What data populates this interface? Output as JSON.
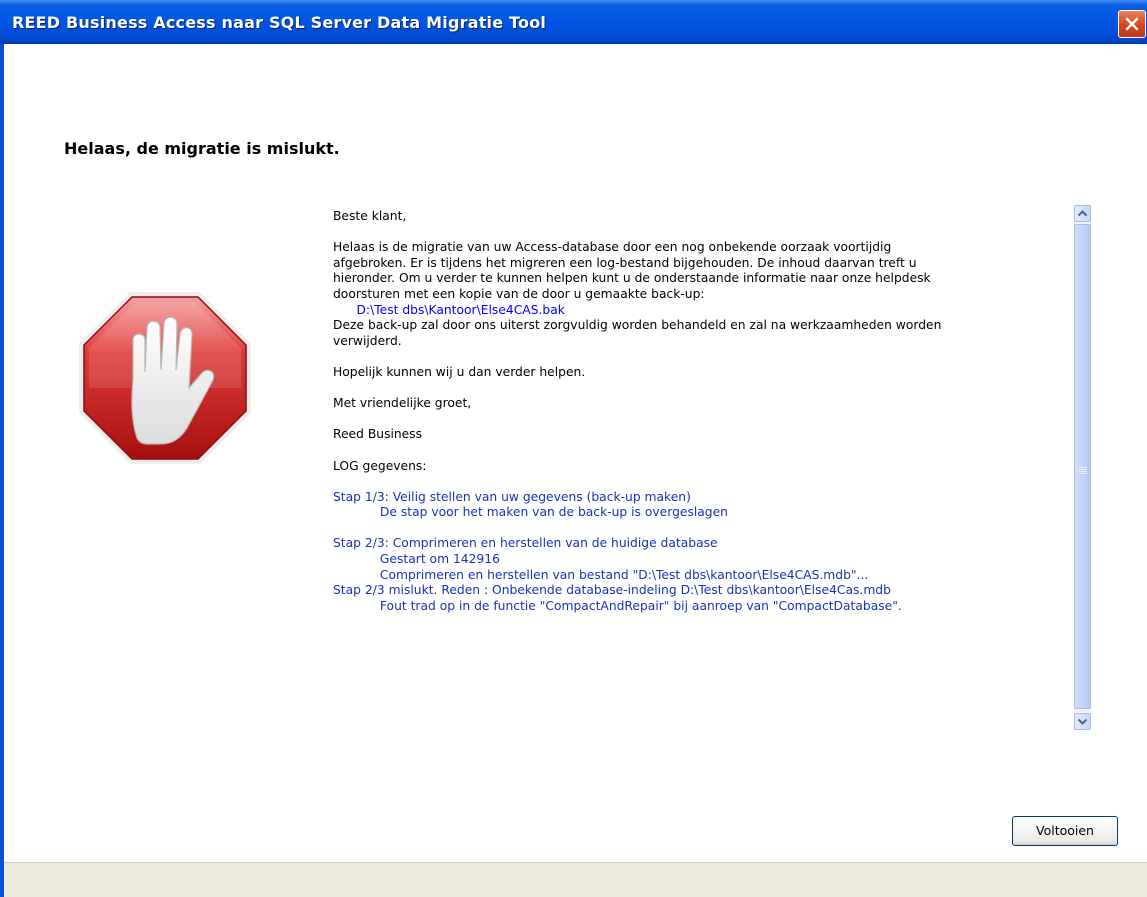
{
  "window": {
    "title": "REED Business Access naar SQL Server Data Migratie Tool",
    "close_icon": "close-icon"
  },
  "page": {
    "heading": "Helaas, de migratie is mislukt.",
    "icon": "stop-hand-icon"
  },
  "message": {
    "greeting": "Beste klant,",
    "paragraph1": [
      "Helaas is de migratie van uw Access-database door een nog onbekende oorzaak voortijdig",
      "afgebroken. Er is tijdens het migreren een log-bestand bijgehouden. De inhoud daarvan treft u",
      "hieronder. Om u verder te kunnen helpen kunt u de onderstaande informatie naar onze helpdesk",
      "doorsturen met een kopie van de door u gemaakte back-up:"
    ],
    "backup_path": "D:\\Test dbs\\Kantoor\\Else4CAS.bak",
    "paragraph2": [
      "Deze back-up zal door ons uiterst zorgvuldig worden behandeld en zal na werkzaamheden worden",
      "verwijderd."
    ],
    "hope": "Hopelijk kunnen wij u dan verder helpen.",
    "closing": "Met vriendelijke groet,",
    "signature": "Reed Business",
    "log_header": "LOG gegevens:",
    "log": [
      "Stap 1/3: Veilig stellen van uw gegevens (back-up maken)",
      "            De stap voor het maken van de back-up is overgeslagen",
      "",
      "Stap 2/3: Comprimeren en herstellen van de huidige database",
      "            Gestart om 142916",
      "            Comprimeren en herstellen van bestand \"D:\\Test dbs\\kantoor\\Else4CAS.mdb\"...",
      "Stap 2/3 mislukt. Reden : Onbekende database-indeling D:\\Test dbs\\kantoor\\Else4Cas.mdb",
      "            Fout trad op in de functie \"CompactAndRepair\" bij aanroep van \"CompactDatabase\"."
    ]
  },
  "buttons": {
    "finish_label": "Voltooien"
  }
}
